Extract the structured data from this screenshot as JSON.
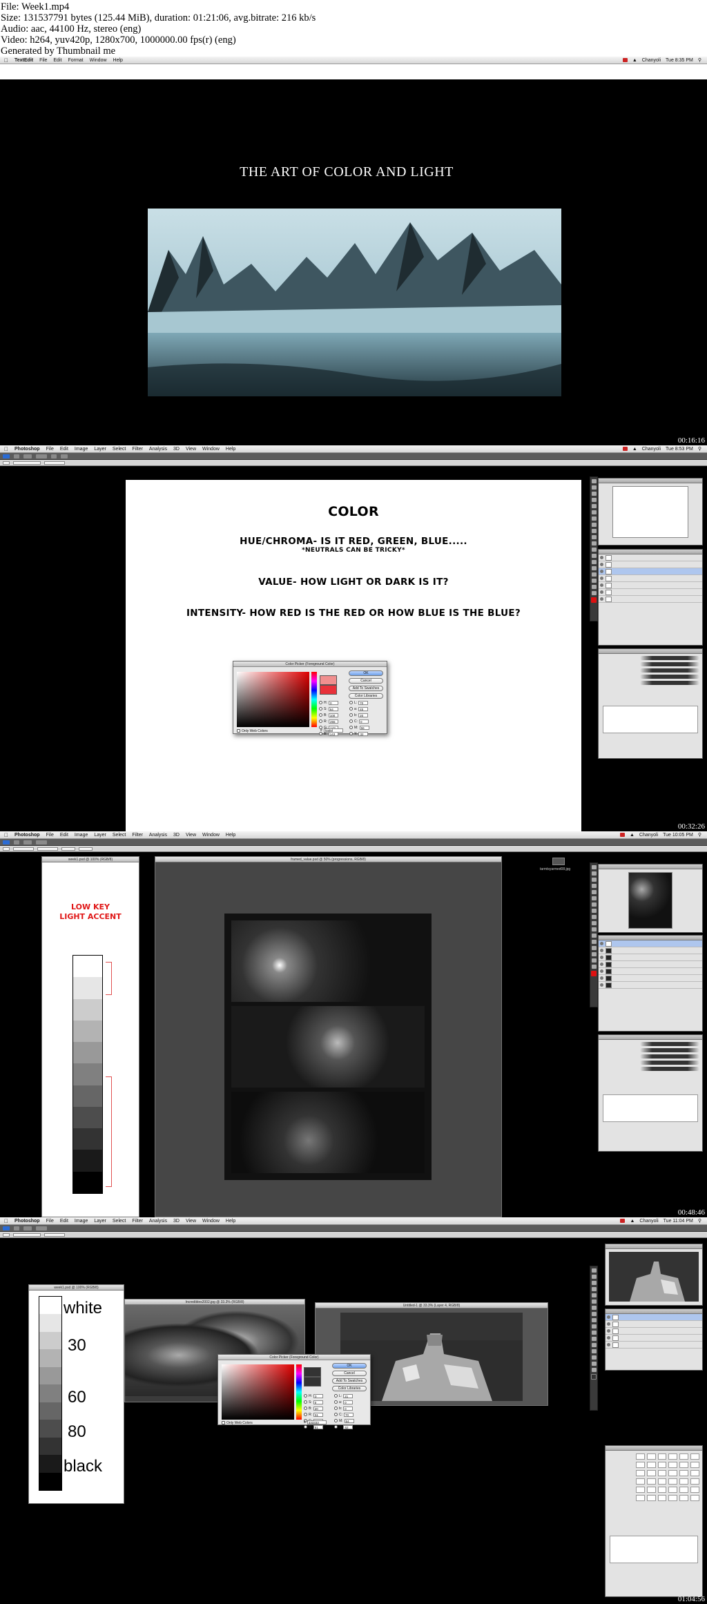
{
  "header": {
    "lines": [
      "File: Week1.mp4",
      "Size: 131537791 bytes (125.44 MiB), duration: 01:21:06, avg.bitrate: 216 kb/s",
      "Audio: aac, 44100 Hz, stereo (eng)",
      "Video: h264, yuv420p, 1280x700, 1000000.00 fps(r) (eng)",
      "Generated by Thumbnail me"
    ]
  },
  "frames": [
    {
      "timestamp": "00:16:16",
      "menubar": {
        "app": "TextEdit",
        "items": [
          "File",
          "Edit",
          "Format",
          "Window",
          "Help"
        ],
        "user": "Chanyoli",
        "clock": "Tue 8:35 PM"
      },
      "slide_title": "THE ART OF COLOR AND LIGHT"
    },
    {
      "timestamp": "00:32:26",
      "menubar": {
        "app": "Photoshop",
        "items": [
          "File",
          "Edit",
          "Image",
          "Layer",
          "Select",
          "Filter",
          "Analysis",
          "3D",
          "View",
          "Window",
          "Help"
        ],
        "user": "Chanyoli",
        "clock": "Tue 8:53 PM"
      },
      "slide": {
        "title": "COLOR",
        "line1": "HUE/CHROMA- IS IT RED, GREEN, BLUE.....",
        "line1_note": "*NEUTRALS CAN BE TRICKY*",
        "line2": "VALUE- HOW LIGHT OR DARK IS IT?",
        "line3": "INTENSITY- HOW RED IS THE RED OR HOW BLUE IS THE BLUE?"
      },
      "color_picker": {
        "title": "Color Picker (Foreground Color)",
        "ok": "OK",
        "cancel": "Cancel",
        "add_swatches": "Add To Swatches",
        "color_libraries": "Color Libraries",
        "only_web": "Only Web Colors",
        "hex": "f08f8f",
        "swatch_color": "#e8313a",
        "fields": [
          {
            "label": "H:",
            "value": "0",
            "label2": "L:",
            "value2": "70"
          },
          {
            "label": "S:",
            "value": "64",
            "label2": "a:",
            "value2": "45"
          },
          {
            "label": "B:",
            "value": "100",
            "label2": "b:",
            "value2": "20"
          },
          {
            "label": "R:",
            "value": "255",
            "label2": "C:",
            "value2": "0"
          },
          {
            "label": "G:",
            "value": "143",
            "label2": "M:",
            "value2": "56"
          },
          {
            "label": "B:",
            "value": "143",
            "label2": "Y:",
            "value2": "32"
          }
        ]
      }
    },
    {
      "timestamp": "00:48:46",
      "menubar": {
        "app": "Photoshop",
        "items": [
          "File",
          "Edit",
          "Image",
          "Layer",
          "Select",
          "Filter",
          "Analysis",
          "3D",
          "View",
          "Window",
          "Help"
        ],
        "user": "Chanyoli",
        "clock": "Tue 10:05 PM"
      },
      "value_scale_title": "week1.psd @ 100% (RGB/8)",
      "scale_label_1": "LOW KEY",
      "scale_label_2": "LIGHT ACCENT",
      "doc_title": "framed_value.psd @ 50% (progressions, RGB/8)",
      "side_label": "tarmtsyarmed08.jpg"
    },
    {
      "timestamp": "01:04:56",
      "menubar": {
        "app": "Photoshop",
        "items": [
          "File",
          "Edit",
          "Image",
          "Layer",
          "Select",
          "Filter",
          "Analysis",
          "3D",
          "View",
          "Window",
          "Help"
        ],
        "user": "Chanyoli",
        "clock": "Tue 11:04 PM"
      },
      "scale_window_title": "week1.psd @ 100% (RGB/8)",
      "scale_labels": [
        "white",
        "30",
        "60",
        "80",
        "black"
      ],
      "photo_window_title": "Incredibles2002.jpg @ 33.3% (RGB/8)",
      "untitled_window_title": "Untitled-1 @ 33.3% (Layer 4, RGB/8)",
      "color_picker": {
        "title": "Color Picker (Foreground Color)",
        "ok": "OK",
        "cancel": "Cancel",
        "add_swatches": "Add To Swatches",
        "color_libraries": "Color Libraries",
        "only_web": "Only Web Colors",
        "hex": "333333",
        "swatch_color": "#333333",
        "fields": [
          {
            "label": "H:",
            "value": "0",
            "label2": "L:",
            "value2": "21"
          },
          {
            "label": "S:",
            "value": "0",
            "label2": "a:",
            "value2": "0"
          },
          {
            "label": "B:",
            "value": "20",
            "label2": "b:",
            "value2": "0"
          },
          {
            "label": "R:",
            "value": "51",
            "label2": "C:",
            "value2": "70"
          },
          {
            "label": "G:",
            "value": "51",
            "label2": "M:",
            "value2": "64"
          },
          {
            "label": "B:",
            "value": "51",
            "label2": "Y:",
            "value2": "62"
          }
        ]
      }
    }
  ]
}
